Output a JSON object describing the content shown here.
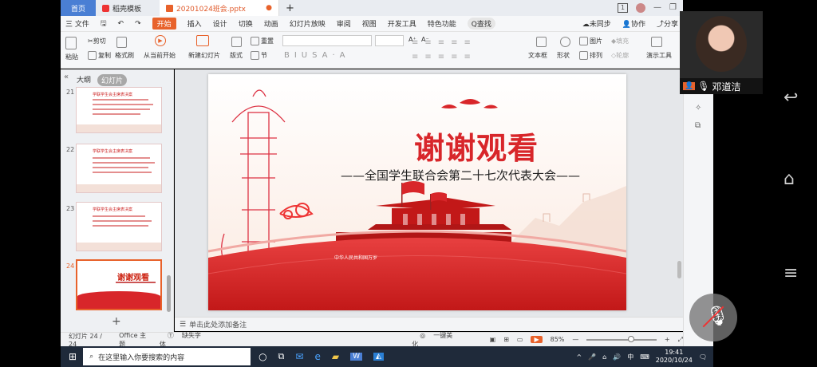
{
  "titlebar": {
    "home_tab": "首页",
    "template_tab": "稻壳模板",
    "doc_tab": "20201024班会.pptx",
    "new_tab_symbol": "+",
    "page_badge": "1"
  },
  "menu": {
    "file": "三 文件",
    "items": [
      "开始",
      "插入",
      "设计",
      "切换",
      "动画",
      "幻灯片放映",
      "审阅",
      "视图",
      "开发工具",
      "特色功能"
    ],
    "find": "Q查找",
    "unsync": "未同步",
    "collab": "协作",
    "share": "分享"
  },
  "ribbon": {
    "paste": "粘贴",
    "cut": "剪切",
    "copy": "复制",
    "format_brush": "格式刷",
    "from_current": "从当前开始",
    "new_slide": "新建幻灯片",
    "layout": "版式",
    "section": "节",
    "reset": "重置",
    "textbox": "文本框",
    "shape": "形状",
    "arrange": "排列",
    "picture": "图片",
    "fill": "填充",
    "outline": "轮廓",
    "presenter_tools": "演示工具",
    "font_grow": "A⁺",
    "font_shrink": "A⁻"
  },
  "panel": {
    "tab_outline": "大纲",
    "tab_slides": "幻灯片",
    "thumbnails": [
      {
        "num": "21",
        "title": "学联学生会主席表决案"
      },
      {
        "num": "22",
        "title": "学联学生会主席表决案"
      },
      {
        "num": "23",
        "title": "学联学生会主席表决案"
      },
      {
        "num": "24",
        "title": "谢谢观看"
      }
    ],
    "add": "+"
  },
  "slide": {
    "title": "谢谢观看",
    "subtitle": "——全国学生联合会第二十七次代表大会——",
    "banner": "中华人民共和国万岁",
    "colors": {
      "primary": "#d8262a",
      "accent": "#e84040"
    }
  },
  "notes": {
    "placeholder": "单击此处添加备注"
  },
  "status": {
    "slide_count": "幻灯片 24 / 24",
    "theme": "Office 主题",
    "missing_font": "缺失字体",
    "beautify": "一键美化",
    "zoom": "85%"
  },
  "taskbar": {
    "search_placeholder": "在这里输入你要搜索的内容",
    "ime": "中",
    "time": "19:41",
    "date": "2020/10/24"
  },
  "video": {
    "name": "邓道洁"
  }
}
